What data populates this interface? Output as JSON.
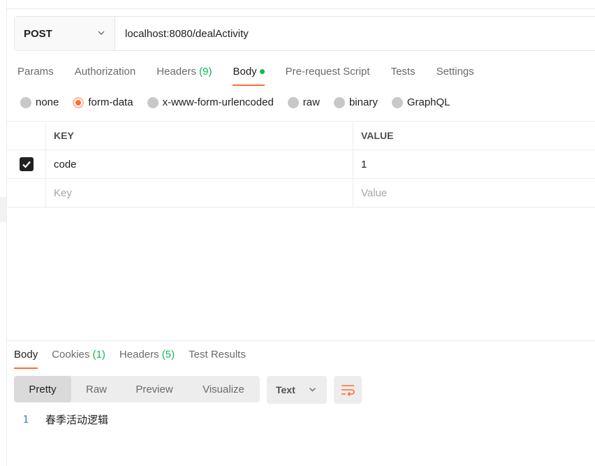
{
  "request": {
    "method": "POST",
    "url": "localhost:8080/dealActivity"
  },
  "request_tabs": [
    {
      "label": "Params"
    },
    {
      "label": "Authorization"
    },
    {
      "label": "Headers",
      "count": "(9)"
    },
    {
      "label": "Body",
      "active": true
    },
    {
      "label": "Pre-request Script"
    },
    {
      "label": "Tests"
    },
    {
      "label": "Settings"
    }
  ],
  "body_types": {
    "none": "none",
    "form_data": "form-data",
    "urlencoded": "x-www-form-urlencoded",
    "raw": "raw",
    "binary": "binary",
    "graphql": "GraphQL",
    "selected": "form-data"
  },
  "params_table": {
    "headers": {
      "key": "KEY",
      "value": "VALUE"
    },
    "rows": [
      {
        "checked": true,
        "key": "code",
        "value": "1"
      }
    ],
    "placeholder": {
      "key": "Key",
      "value": "Value"
    }
  },
  "response_tabs": {
    "body": "Body",
    "cookies": "Cookies",
    "cookies_count": "(1)",
    "headers": "Headers",
    "headers_count": "(5)",
    "test_results": "Test Results"
  },
  "response_toolbar": {
    "pretty": "Pretty",
    "raw": "Raw",
    "preview": "Preview",
    "visualize": "Visualize",
    "format": "Text"
  },
  "response_body": {
    "line_number": "1",
    "text": "春季活动逻辑"
  },
  "colors": {
    "accent": "#ff6c37",
    "success": "#0cbb52",
    "line_number": "#3b7bb8"
  }
}
